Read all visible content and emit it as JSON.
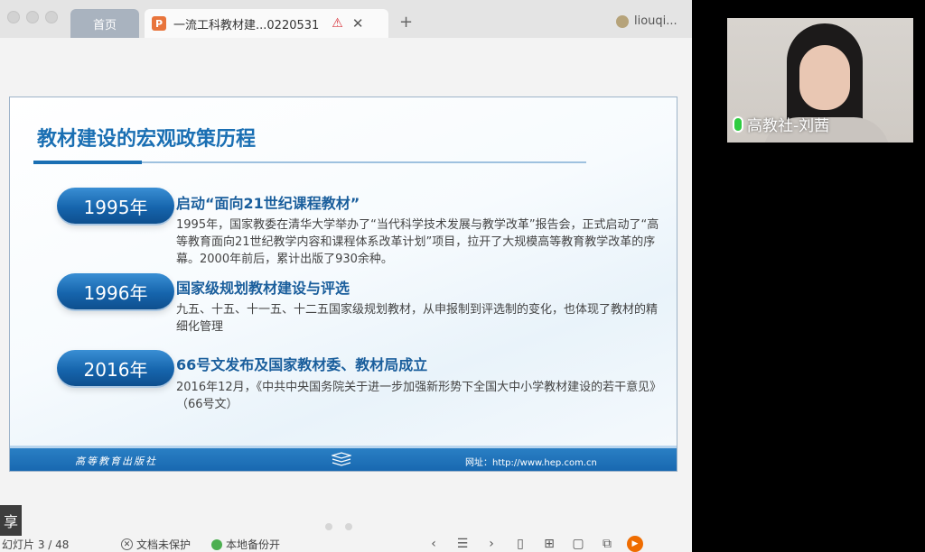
{
  "tabs": {
    "home_label": "首页",
    "doc_icon": "P",
    "doc_title": "一流工科教材建...0220531",
    "warn_icon": "⚠",
    "close_icon": "✕",
    "new_tab_icon": "+",
    "user_name": "liouqi..."
  },
  "slide": {
    "title": "教材建设的宏观政策历程",
    "items": [
      {
        "year": "1995年",
        "heading": "启动“面向21世纪课程教材”",
        "body": "1995年，国家教委在清华大学举办了“当代科学技术发展与教学改革”报告会，正式启动了“高等教育面向21世纪教学内容和课程体系改革计划”项目，拉开了大规模高等教育教学改革的序幕。2000年前后，累计出版了930余种。"
      },
      {
        "year": "1996年",
        "heading": "国家级规划教材建设与评选",
        "body": "九五、十五、十一五、十二五国家级规划教材，从申报制到评选制的变化，也体现了教材的精细化管理"
      },
      {
        "year": "2016年",
        "heading": "66号文发布及国家教材委、教材局成立",
        "body": "2016年12月，《中共中央国务院关于进一步加强新形势下全国大中小学教材建设的若干意见》（66号文）"
      }
    ],
    "footer_publisher": "高等教育出版社",
    "footer_url": "网址：http://www.hep.com.cn"
  },
  "statusbar": {
    "share_label": "享",
    "slide_counter": "幻灯片 3 / 48",
    "doc_protect": "文档未保护",
    "local_backup": "本地备份开",
    "tools": [
      "‹",
      "☰",
      "›",
      "▯",
      "⊞",
      "▢",
      "⧉",
      "▶"
    ]
  },
  "video": {
    "participant_name": "高教社-刘茜"
  },
  "colors": {
    "accent": "#1a6fb3",
    "pill": "#1665ad",
    "footer": "#1868b0"
  }
}
